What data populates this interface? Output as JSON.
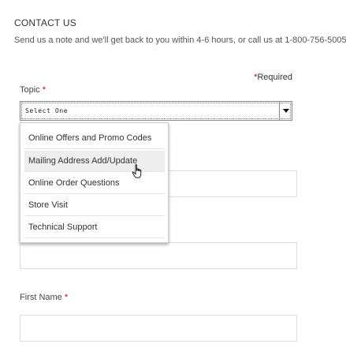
{
  "header": {
    "title": "CONTACT US",
    "subtitle": "Send us a note and we'll get back to you within 4-6 hours, or call us at 1-800-756-5005."
  },
  "form": {
    "required_asterisk": "*",
    "required_text": "Required",
    "topic": {
      "label": "Topic",
      "selected": "Select One",
      "options": [
        "Online Offers and Promo Codes",
        "Mailing Address Add/Update",
        "Online Order Questions",
        "Store Visit",
        "Technical Support"
      ],
      "hovered_option": "Mailing Address Add/Update"
    },
    "first_name": {
      "label": "First Name",
      "value": ""
    }
  },
  "colors": {
    "required_red": "#cc0000",
    "text": "#333333",
    "border": "#dddddd",
    "hover_bg": "#eeeeee"
  },
  "icons": {
    "select_arrow": "caret-down-icon",
    "pointer": "hand-pointer-icon"
  }
}
